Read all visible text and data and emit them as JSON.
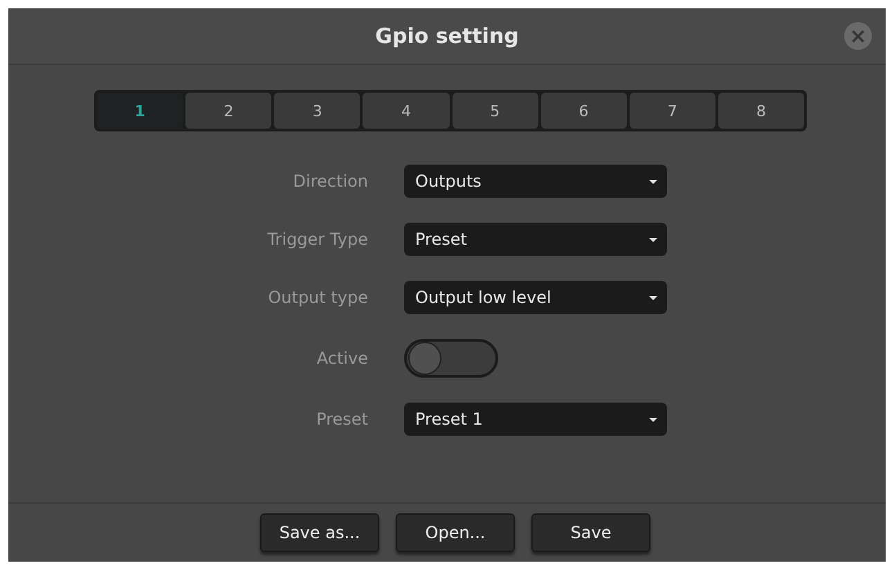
{
  "window": {
    "title": "Gpio setting",
    "close": "×"
  },
  "tabs": [
    {
      "label": "1",
      "selected": true
    },
    {
      "label": "2",
      "selected": false
    },
    {
      "label": "3",
      "selected": false
    },
    {
      "label": "4",
      "selected": false
    },
    {
      "label": "5",
      "selected": false
    },
    {
      "label": "6",
      "selected": false
    },
    {
      "label": "7",
      "selected": false
    },
    {
      "label": "8",
      "selected": false
    }
  ],
  "fields": [
    {
      "kind": "dropdown",
      "label": "Direction",
      "value": "Outputs"
    },
    {
      "kind": "dropdown",
      "label": "Trigger Type",
      "value": "Preset"
    },
    {
      "kind": "dropdown",
      "label": "Output type",
      "value": "Output low level"
    },
    {
      "kind": "toggle",
      "label": "Active",
      "on": false
    },
    {
      "kind": "dropdown",
      "label": "Preset",
      "value": "Preset 1"
    }
  ],
  "buttons": [
    "Save as...",
    "Open...",
    "Save"
  ]
}
